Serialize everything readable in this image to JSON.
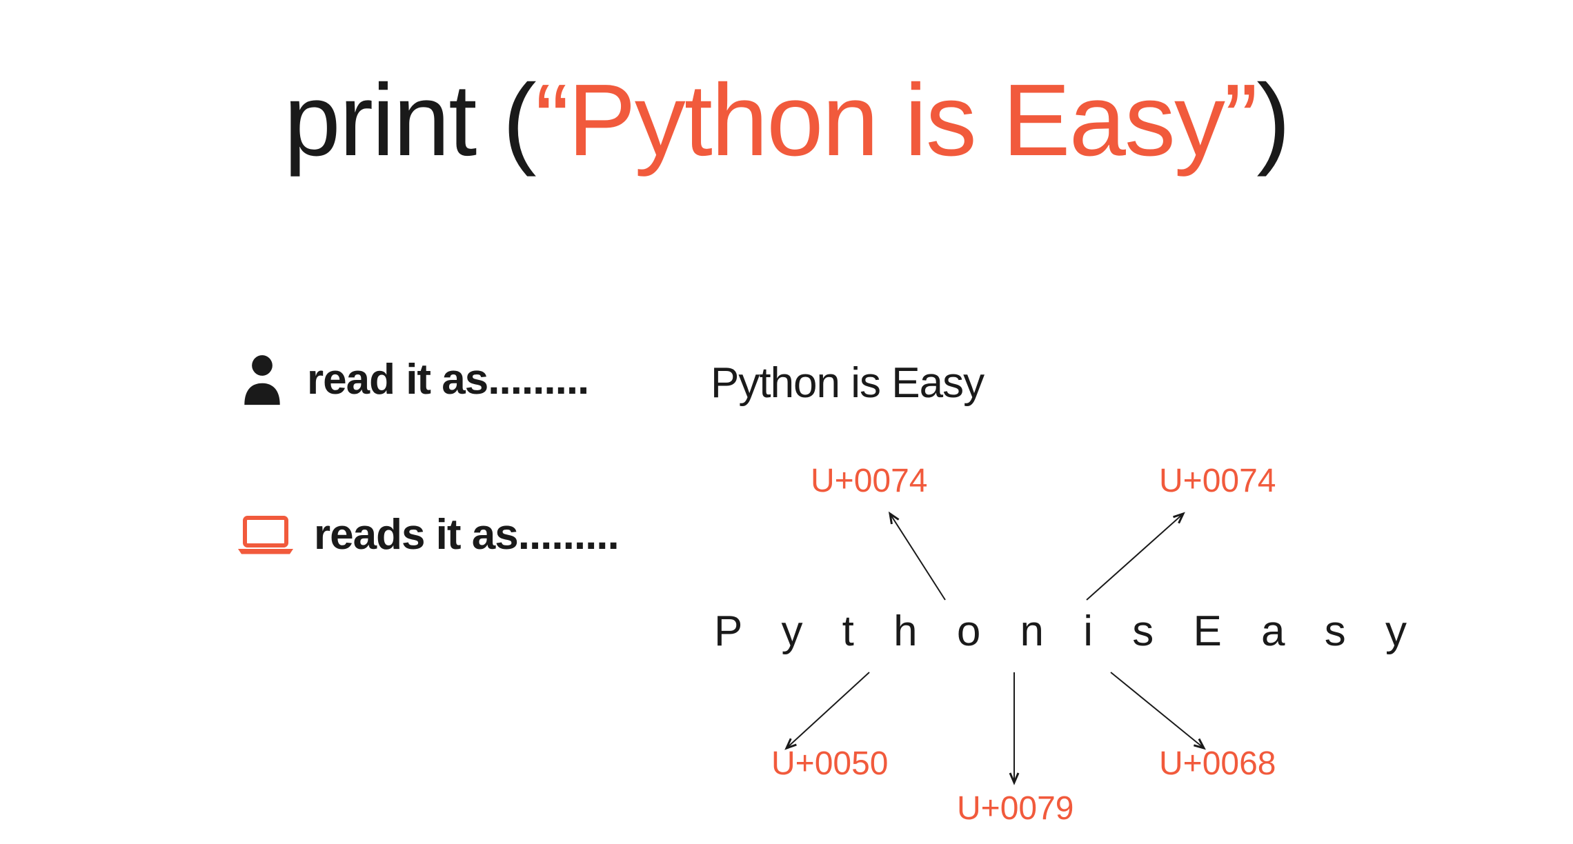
{
  "title": {
    "before": "print (",
    "open_quote": "“",
    "content": "Python is Easy",
    "close_quote": "”",
    "after": ")"
  },
  "human": {
    "label": "read it as.........",
    "value": "Python is Easy"
  },
  "computer": {
    "label": "reads it as.........",
    "value": "P y t h o n  i s  E a s y"
  },
  "codes": {
    "c1": "U+0074",
    "c2": "U+0074",
    "c3": "U+0050",
    "c4": "U+0079",
    "c5": "U+0068"
  },
  "colors": {
    "accent": "#f15a3c",
    "text": "#1a1a1a"
  }
}
